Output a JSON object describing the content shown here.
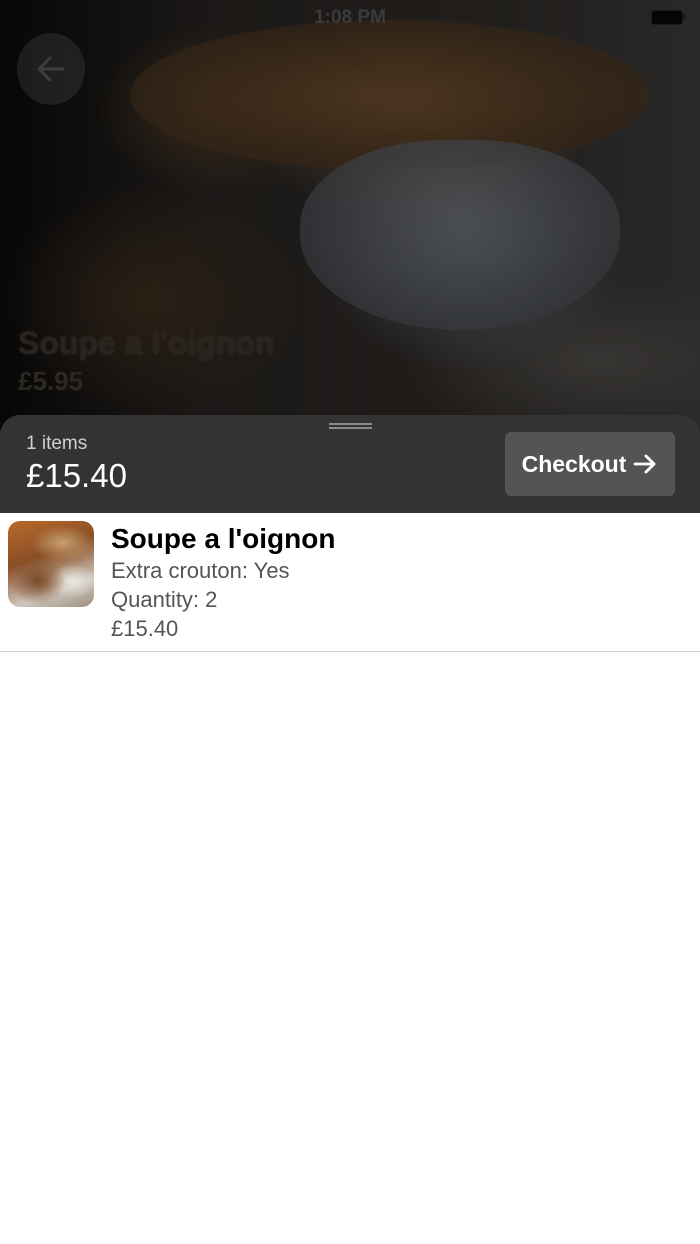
{
  "status_bar": {
    "time": "1:08 PM"
  },
  "hero": {
    "back_icon": "arrow-left-icon",
    "title": "Soupe a l'oignon",
    "price": "£5.95"
  },
  "cart_bar": {
    "item_count": "1 items",
    "total": "£15.40",
    "checkout_label": "Checkout",
    "checkout_icon": "arrow-right-icon"
  },
  "cart_items": [
    {
      "name": "Soupe a l'oignon",
      "option": "Extra crouton: Yes",
      "quantity": "Quantity: 2",
      "price": "£15.40"
    }
  ],
  "colors": {
    "cart_bar_bg": "#333333",
    "checkout_button_bg": "#545454",
    "text_primary": "#000000",
    "text_secondary": "#555555"
  }
}
